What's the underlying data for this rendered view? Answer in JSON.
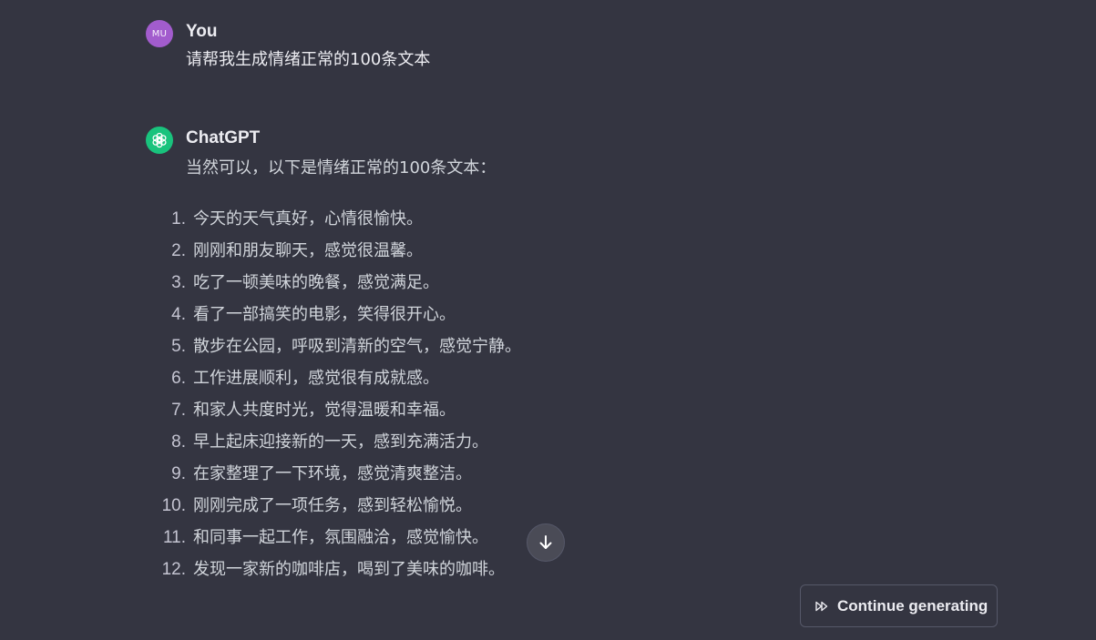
{
  "conversation": {
    "user_message": {
      "avatar_initials": "MU",
      "author": "You",
      "text": "请帮我生成情绪正常的100条文本"
    },
    "assistant_message": {
      "author": "ChatGPT",
      "avatar_icon": "openai-logo-icon",
      "intro": "当然可以，以下是情绪正常的100条文本：",
      "items": [
        {
          "num": "1.",
          "text": "今天的天气真好，心情很愉快。"
        },
        {
          "num": "2.",
          "text": "刚刚和朋友聊天，感觉很温馨。"
        },
        {
          "num": "3.",
          "text": "吃了一顿美味的晚餐，感觉满足。"
        },
        {
          "num": "4.",
          "text": "看了一部搞笑的电影，笑得很开心。"
        },
        {
          "num": "5.",
          "text": "散步在公园，呼吸到清新的空气，感觉宁静。"
        },
        {
          "num": "6.",
          "text": "工作进展顺利，感觉很有成就感。"
        },
        {
          "num": "7.",
          "text": "和家人共度时光，觉得温暖和幸福。"
        },
        {
          "num": "8.",
          "text": "早上起床迎接新的一天，感到充满活力。"
        },
        {
          "num": "9.",
          "text": "在家整理了一下环境，感觉清爽整洁。"
        },
        {
          "num": "10.",
          "text": "刚刚完成了一项任务，感到轻松愉悦。"
        },
        {
          "num": "11.",
          "text": "和同事一起工作，氛围融洽，感觉愉快。"
        },
        {
          "num": "12.",
          "text": "发现一家新的咖啡店，喝到了美味的咖啡。"
        }
      ]
    }
  },
  "controls": {
    "scroll_down_icon": "arrow-down-icon",
    "continue_icon": "fast-forward-icon",
    "continue_label": "Continue generating"
  },
  "colors": {
    "background": "#343541",
    "user_avatar": "#a25ccd",
    "assistant_avatar": "#19c37d",
    "text": "#ececf1"
  }
}
